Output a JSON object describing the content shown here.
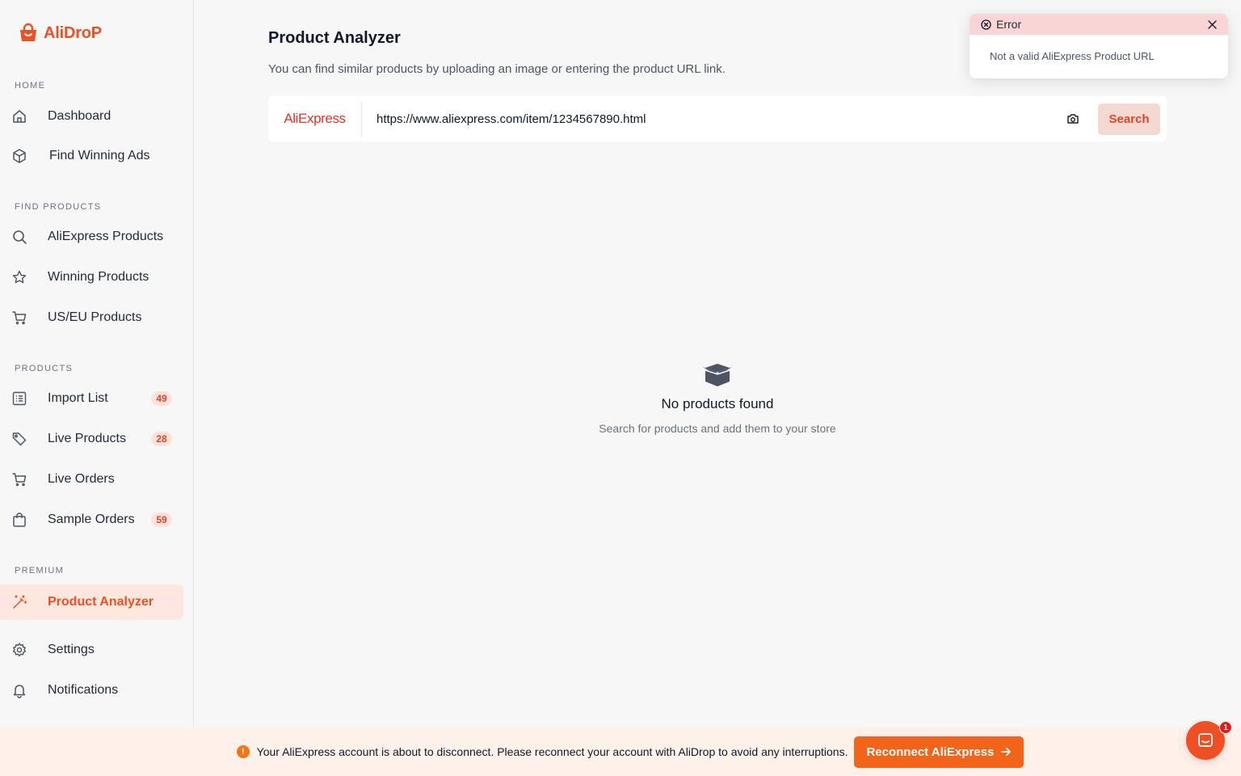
{
  "app": {
    "name": "AliDroP",
    "accent": "#f04f23"
  },
  "sidebar": {
    "sections": {
      "home": "HOME",
      "find_products": "FIND PRODUCTS",
      "products": "PRODUCTS",
      "premium": "PREMIUM"
    },
    "items": [
      {
        "label": "Dashboard",
        "icon": "home-icon"
      },
      {
        "label": "Find Winning Ads",
        "icon": "cube-icon"
      },
      {
        "label": "AliExpress Products",
        "icon": "search-icon"
      },
      {
        "label": "Winning Products",
        "icon": "star-icon"
      },
      {
        "label": "US/EU Products",
        "icon": "cart-icon"
      },
      {
        "label": "Import List",
        "icon": "list-icon",
        "badge": "49"
      },
      {
        "label": "Live Products",
        "icon": "tag-icon",
        "badge": "28"
      },
      {
        "label": "Live Orders",
        "icon": "cart-icon"
      },
      {
        "label": "Sample Orders",
        "icon": "bag-icon",
        "badge": "59"
      },
      {
        "label": "Product Analyzer",
        "icon": "magic-wand-icon",
        "active": true
      },
      {
        "label": "Settings",
        "icon": "gear-icon"
      },
      {
        "label": "Notifications",
        "icon": "bell-icon"
      }
    ]
  },
  "main": {
    "title": "Product Analyzer",
    "subtitle": "You can find similar products by uploading an image or entering the product URL link.",
    "search": {
      "source": "AliExpress",
      "value": "https://www.aliexpress.com/item/1234567890.html",
      "button": "Search"
    },
    "empty": {
      "title": "No products found",
      "subtitle": "Search for products and add them to your store"
    }
  },
  "toast": {
    "title": "Error",
    "message": "Not a valid AliExpress Product URL"
  },
  "banner": {
    "text": "Your AliExpress account is about to disconnect. Please reconnect your account with AliDrop to avoid any interruptions.",
    "button": "Reconnect AliExpress"
  },
  "chat": {
    "unread": "1"
  }
}
